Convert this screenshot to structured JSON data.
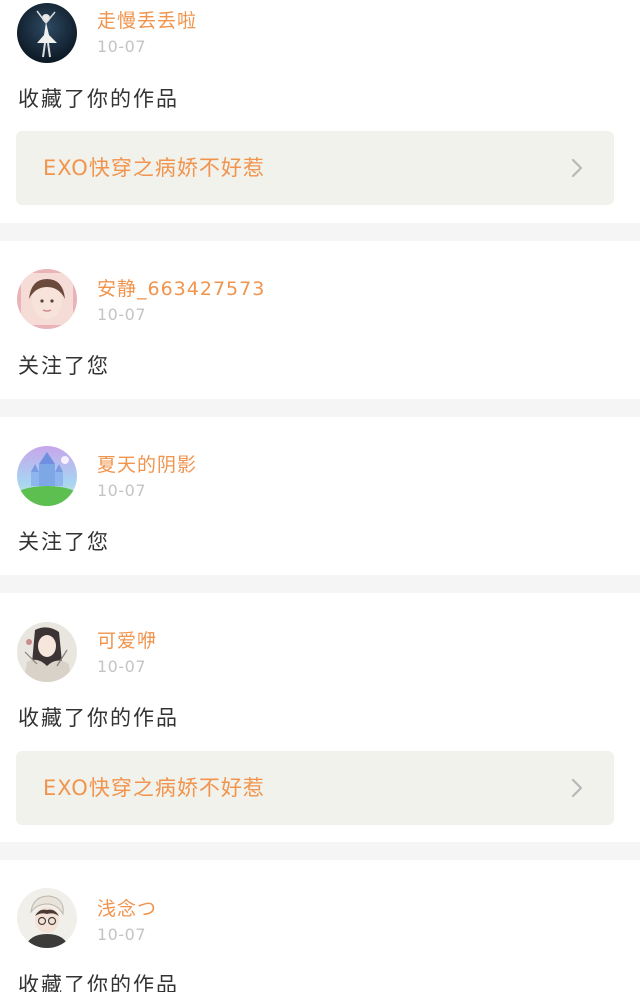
{
  "theme": {
    "accent": "#f0944e",
    "separator": "#f5f5f5",
    "work_bg": "#f2f2ec",
    "time_color": "#c4c4c4"
  },
  "feed": [
    {
      "name": "走慢丢丢啦",
      "time": "10-07",
      "action": "收藏了你的作品",
      "work": "EXO快穿之病娇不好惹",
      "avatar": "avatar-ballerina"
    },
    {
      "name": "安静_663427573",
      "time": "10-07",
      "action": "关注了您",
      "avatar": "avatar-girl-photo"
    },
    {
      "name": "夏天的阴影",
      "time": "10-07",
      "action": "关注了您",
      "avatar": "avatar-castle"
    },
    {
      "name": "可爱咿",
      "time": "10-07",
      "action": "收藏了你的作品",
      "work": "EXO快穿之病娇不好惹",
      "avatar": "avatar-anime-girl"
    },
    {
      "name": "浅念つ",
      "time": "10-07",
      "action": "收藏了你的作品",
      "avatar": "avatar-boy"
    }
  ]
}
